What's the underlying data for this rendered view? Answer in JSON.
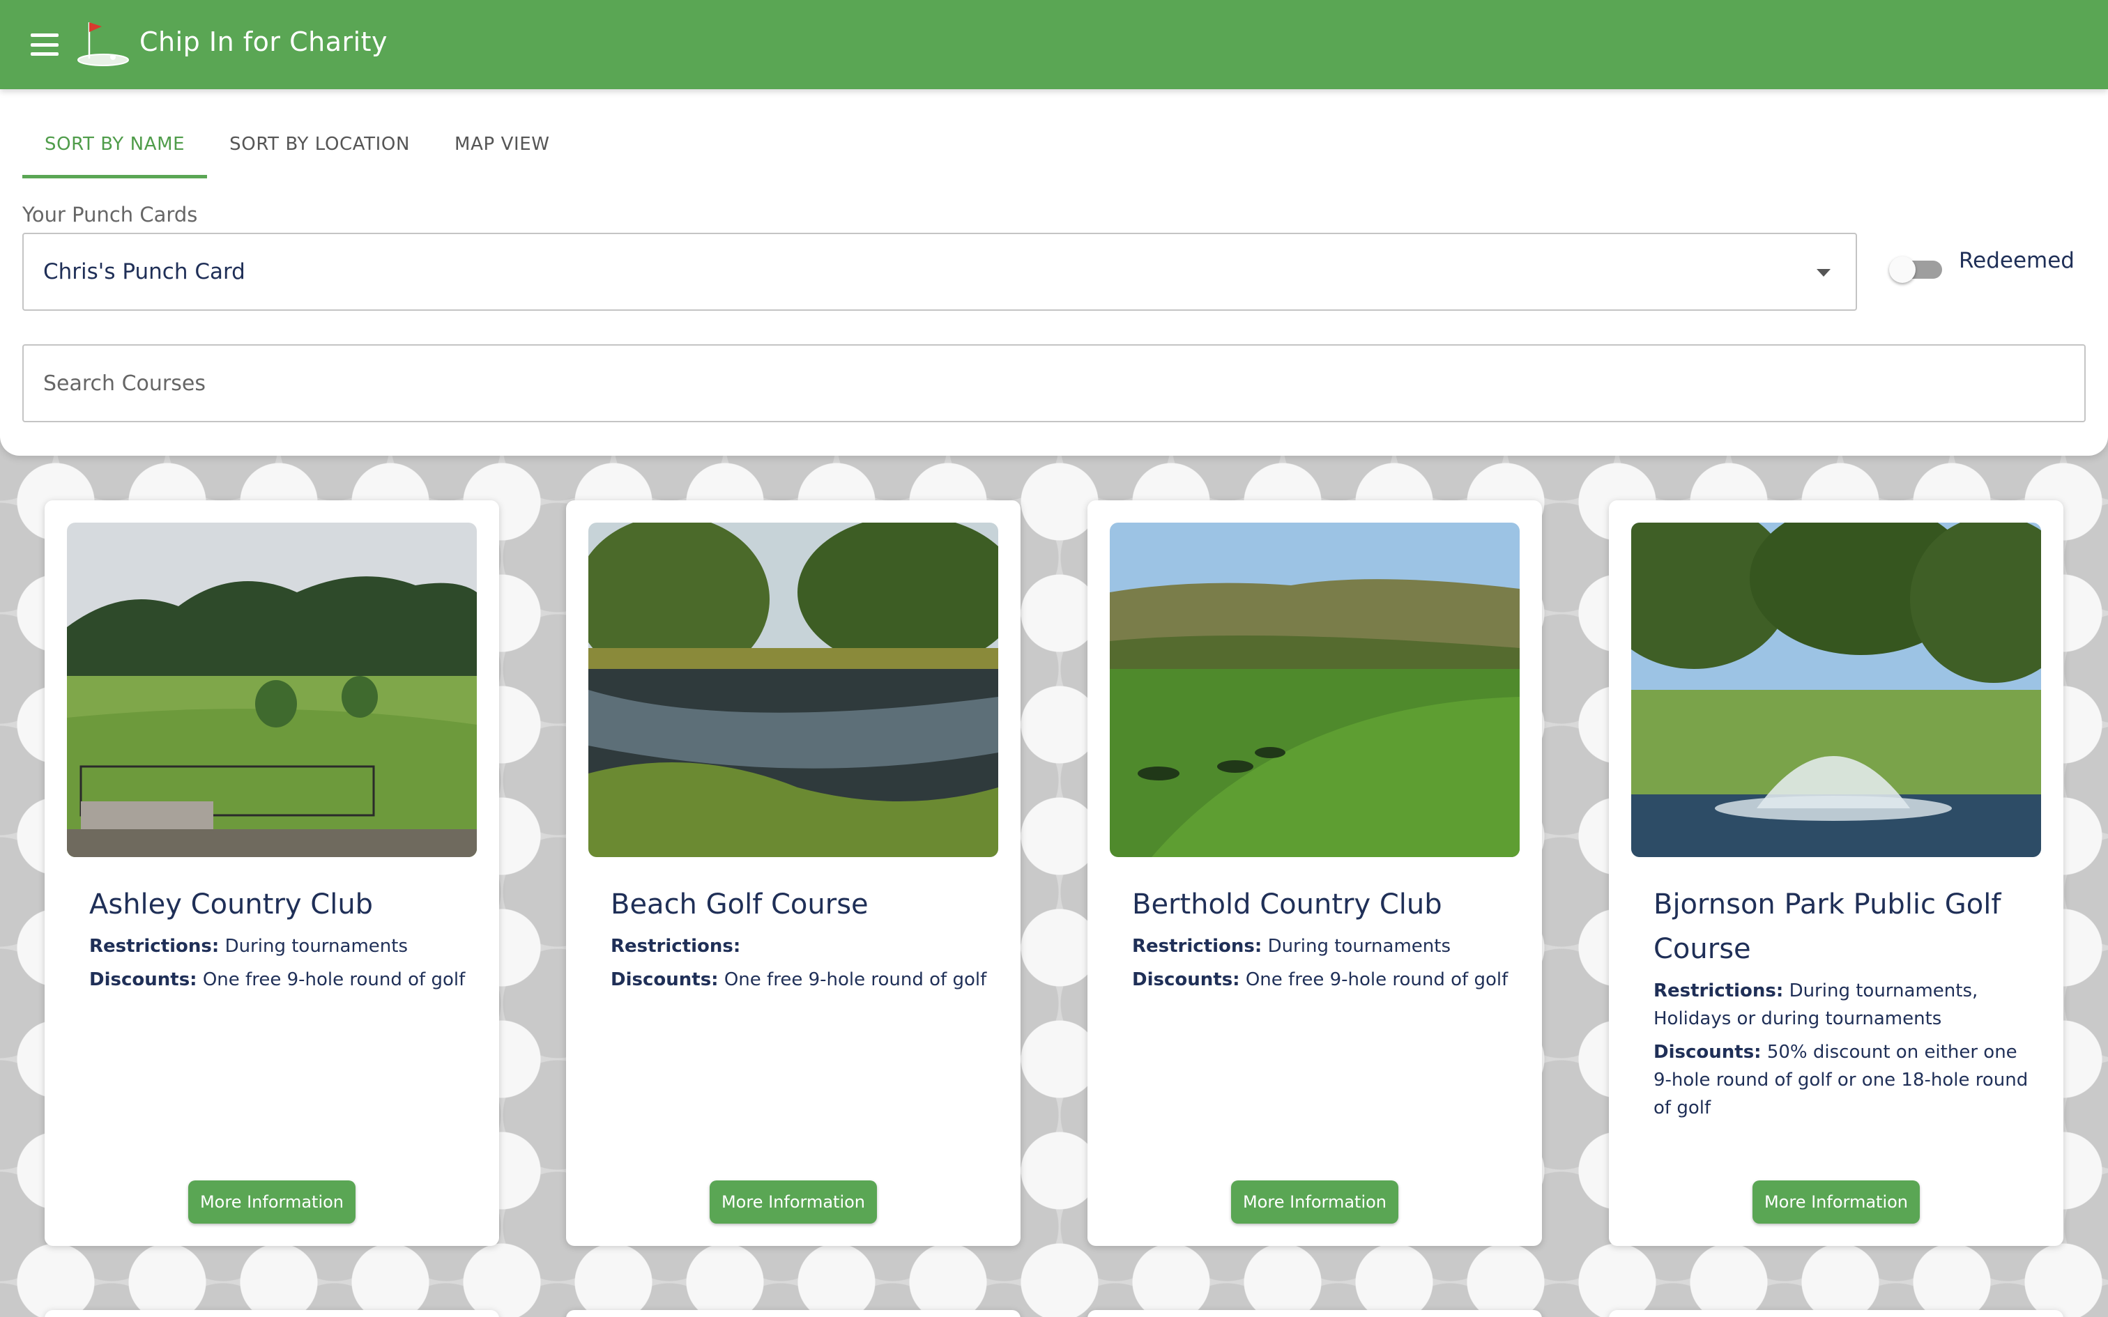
{
  "app": {
    "title": "Chip In for Charity",
    "menu_icon": "menu-icon",
    "logo_icon": "golf-flag-logo",
    "brand_color": "#5aa654"
  },
  "tabs": [
    {
      "label": "SORT BY NAME",
      "active": true
    },
    {
      "label": "SORT BY LOCATION",
      "active": false
    },
    {
      "label": "MAP VIEW",
      "active": false
    }
  ],
  "punch_cards": {
    "label": "Your Punch Cards",
    "selected": "Chris's Punch Card"
  },
  "redeemed_toggle": {
    "label": "Redeemed",
    "on": false
  },
  "search": {
    "placeholder": "Search Courses",
    "value": ""
  },
  "labels": {
    "restrictions": "Restrictions:",
    "discounts": "Discounts:",
    "more_info": "More Information"
  },
  "courses": [
    {
      "name": "Ashley Country Club",
      "restrictions": "During tournaments",
      "discounts": "One free 9-hole round of golf"
    },
    {
      "name": "Beach Golf Course",
      "restrictions": "",
      "discounts": "One free 9-hole round of golf"
    },
    {
      "name": "Berthold Country Club",
      "restrictions": "During tournaments",
      "discounts": "One free 9-hole round of golf"
    },
    {
      "name": "Bjornson Park Public Golf Course",
      "restrictions": "During tournaments, Holidays or during tournaments",
      "discounts": "50% discount on either one 9-hole round of golf or one 18-hole round of golf"
    }
  ]
}
